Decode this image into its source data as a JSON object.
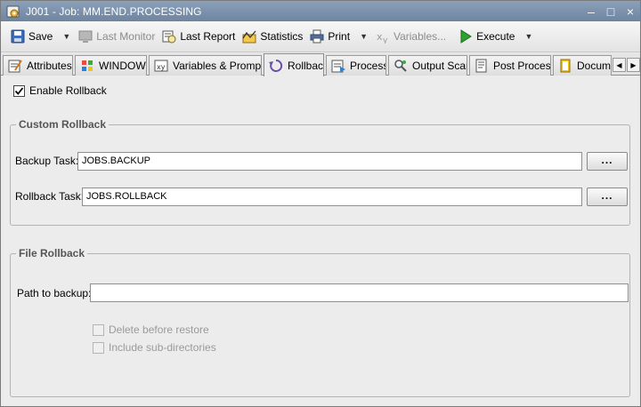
{
  "window": {
    "title": "J001 - Job: MM.END.PROCESSING",
    "minimize": "–",
    "maximize": "□",
    "close": "×"
  },
  "toolbar": {
    "save": "Save",
    "last_monitor": "Last Monitor",
    "last_report": "Last Report",
    "statistics": "Statistics",
    "print": "Print",
    "variables": "Variables...",
    "execute": "Execute"
  },
  "tabs": [
    {
      "label": "Attributes",
      "icon": "attributes-icon"
    },
    {
      "label": "WINDOWS",
      "icon": "windows-logo-icon"
    },
    {
      "label": "Variables & Prompts",
      "icon": "variables-icon"
    },
    {
      "label": "Rollback",
      "icon": "rollback-icon",
      "active": true
    },
    {
      "label": "Process",
      "icon": "process-icon"
    },
    {
      "label": "Output Scan",
      "icon": "output-scan-icon"
    },
    {
      "label": "Post Process",
      "icon": "post-process-icon"
    },
    {
      "label": "Documentation",
      "icon": "documentation-icon"
    }
  ],
  "rollback": {
    "enable_label": "Enable Rollback",
    "enable_checked": true,
    "custom_title": "Custom Rollback",
    "backup_label": "Backup Task:",
    "backup_value": "JOBS.BACKUP",
    "rollback_label": "Rollback Task:",
    "rollback_value": "JOBS.ROLLBACK",
    "browse_label": "...",
    "file_title": "File Rollback",
    "path_label": "Path to backup:",
    "path_value": "",
    "delete_label": "Delete before restore",
    "subdirs_label": "Include sub-directories"
  }
}
